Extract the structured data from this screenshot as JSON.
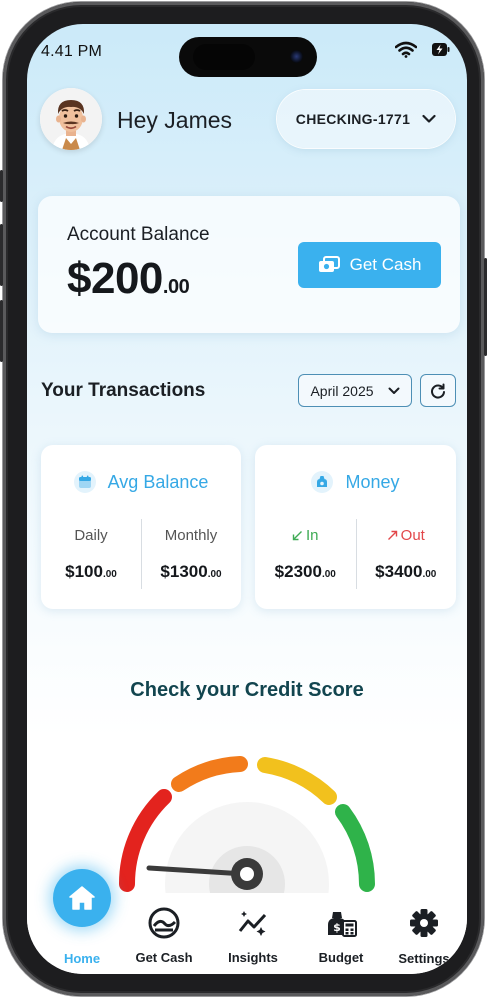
{
  "status_bar": {
    "time": "4.41 PM",
    "icons": [
      "wifi-icon",
      "battery-charging-icon"
    ]
  },
  "header": {
    "greeting": "Hey James",
    "account": "CHECKING-1771"
  },
  "balance": {
    "label": "Account Balance",
    "amount": "$200",
    "cents": ".00",
    "get_cash_label": "Get Cash"
  },
  "transactions": {
    "title": "Your Transactions",
    "month": "April 2025",
    "avg_balance": {
      "title": "Avg Balance",
      "daily_label": "Daily",
      "daily_value": "$100",
      "daily_cents": ".00",
      "monthly_label": "Monthly",
      "monthly_value": "$1300",
      "monthly_cents": ".00"
    },
    "money": {
      "title": "Money",
      "in_label": "In",
      "in_value": "$2300",
      "in_cents": ".00",
      "out_label": "Out",
      "out_value": "$3400",
      "out_cents": ".00"
    }
  },
  "credit": {
    "title": "Check your Credit Score"
  },
  "nav": {
    "home": "Home",
    "get_cash": "Get Cash",
    "insights": "Insights",
    "budget": "Budget",
    "settings": "Settings"
  },
  "colors": {
    "accent": "#3ab1ee",
    "in": "#3fab55",
    "out": "#e2474a",
    "credit_title": "#12454f"
  }
}
